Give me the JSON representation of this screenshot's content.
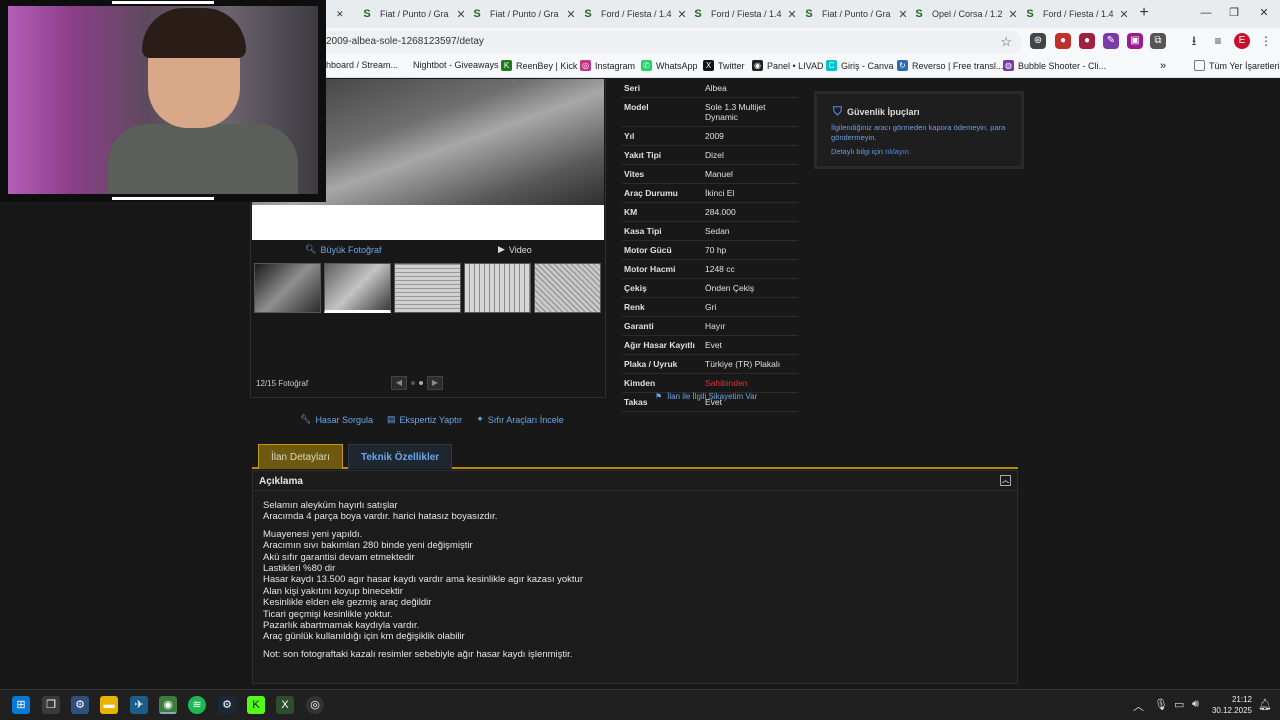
{
  "browser": {
    "tabs": [
      {
        "icon": "S",
        "title": "Fiat / Punto / Gra"
      },
      {
        "icon": "S",
        "title": "Fiat / Punto / Gra"
      },
      {
        "icon": "S",
        "title": "Ford / Fiesta / 1.4"
      },
      {
        "icon": "S",
        "title": "Ford / Fiesta / 1.4"
      },
      {
        "icon": "S",
        "title": "Fiat / Punto / Gra"
      },
      {
        "icon": "S",
        "title": "Opel / Corsa / 1.2"
      },
      {
        "icon": "S",
        "title": "Ford / Fiesta / 1.4"
      }
    ],
    "url": "2009-albea-sole-1268123597/detay",
    "bookmarks": [
      {
        "label": "hboard / Stream...",
        "icon": ""
      },
      {
        "label": "Nightbot - Giveaways",
        "icon": ""
      },
      {
        "label": "ReenBey | Kick",
        "icon": "K"
      },
      {
        "label": "Instagram",
        "icon": "◎"
      },
      {
        "label": "WhatsApp",
        "icon": "✆"
      },
      {
        "label": "Twitter",
        "icon": "X"
      },
      {
        "label": "Panel • LIVAD",
        "icon": "◉"
      },
      {
        "label": "Giriş - Canva",
        "icon": "C"
      },
      {
        "label": "Reverso | Free transl...",
        "icon": "↻"
      },
      {
        "label": "Bubble Shooter - Cli...",
        "icon": "◍"
      }
    ],
    "all_bookmarks": "Tüm Yer İşaretleri",
    "profile_letter": "E"
  },
  "photos": {
    "big_photo": "Büyük Fotoğraf",
    "video": "Video",
    "count": "12/15 Fotoğraf"
  },
  "utility_links": {
    "damage": "Hasar Sorgula",
    "expertise": "Ekspertiz Yaptır",
    "new_cars": "Sıfır Araçları İncele"
  },
  "specs": [
    {
      "key": "Seri",
      "value": "Albea"
    },
    {
      "key": "Model",
      "value": "Sole 1.3 Multijet Dynamic"
    },
    {
      "key": "Yıl",
      "value": "2009"
    },
    {
      "key": "Yakıt Tipi",
      "value": "Dizel"
    },
    {
      "key": "Vites",
      "value": "Manuel"
    },
    {
      "key": "Araç Durumu",
      "value": "İkinci El"
    },
    {
      "key": "KM",
      "value": "284.000"
    },
    {
      "key": "Kasa Tipi",
      "value": "Sedan"
    },
    {
      "key": "Motor Gücü",
      "value": "70 hp"
    },
    {
      "key": "Motor Hacmi",
      "value": "1248 cc"
    },
    {
      "key": "Çekiş",
      "value": "Önden Çekiş"
    },
    {
      "key": "Renk",
      "value": "Gri"
    },
    {
      "key": "Garanti",
      "value": "Hayır"
    },
    {
      "key": "Ağır Hasar Kayıtlı",
      "value": "Evet"
    },
    {
      "key": "Plaka / Uyruk",
      "value": "Türkiye (TR) Plakalı"
    },
    {
      "key": "Kimden",
      "value": "Sahibinden"
    },
    {
      "key": "Takas",
      "value": "Evet"
    }
  ],
  "complaint_link": "İlan ile İlgili Şikayetim Var",
  "safety": {
    "title": "Güvenlik İpuçları",
    "text": "İlgilendiğiniz aracı görmeden kapora ödemeyin, para göndermeyin.",
    "more_prefix": "Detaylı bilgi için",
    "more_link": "tıklayın."
  },
  "detail_tabs": {
    "active": "İlan Detayları",
    "inactive": "Teknik Özellikler"
  },
  "description": {
    "heading": "Açıklama",
    "lines_1": [
      "Selamın aleyküm hayırlı satışlar",
      "Aracımda 4 parça boya vardır. harici hatasız boyasızdır."
    ],
    "lines_2": [
      "Muayenesi yeni yapıldı.",
      "Aracımın sıvı bakımları 280 binde yeni değişmiştir",
      "Akü sıfır garantisi devam etmektedir",
      "Lastikleri %80 dir",
      "Hasar kaydı 13.500 agır hasar kaydı vardır ama kesinlikle agır kazası yoktur",
      "Alan kişi yakıtını koyup binecektir",
      "Kesinlikle elden ele gezmiş araç değildir",
      "Ticari geçmişi kesinlikle yoktur.",
      "Pazarlık abartmamak kaydıyla vardır.",
      "Araç günlük kullanıldığı için km değişiklik olabilir"
    ],
    "note": "Not: son fotograftaki kazalı resimler sebebiyle ağır hasar kaydı işlenmiştir."
  },
  "taskbar": {
    "time": "21:12",
    "date": "30.12.2025"
  },
  "colors": {
    "link": "#6aa6e8",
    "accent_gold": "#b88a08",
    "warning_red": "#e23030"
  }
}
